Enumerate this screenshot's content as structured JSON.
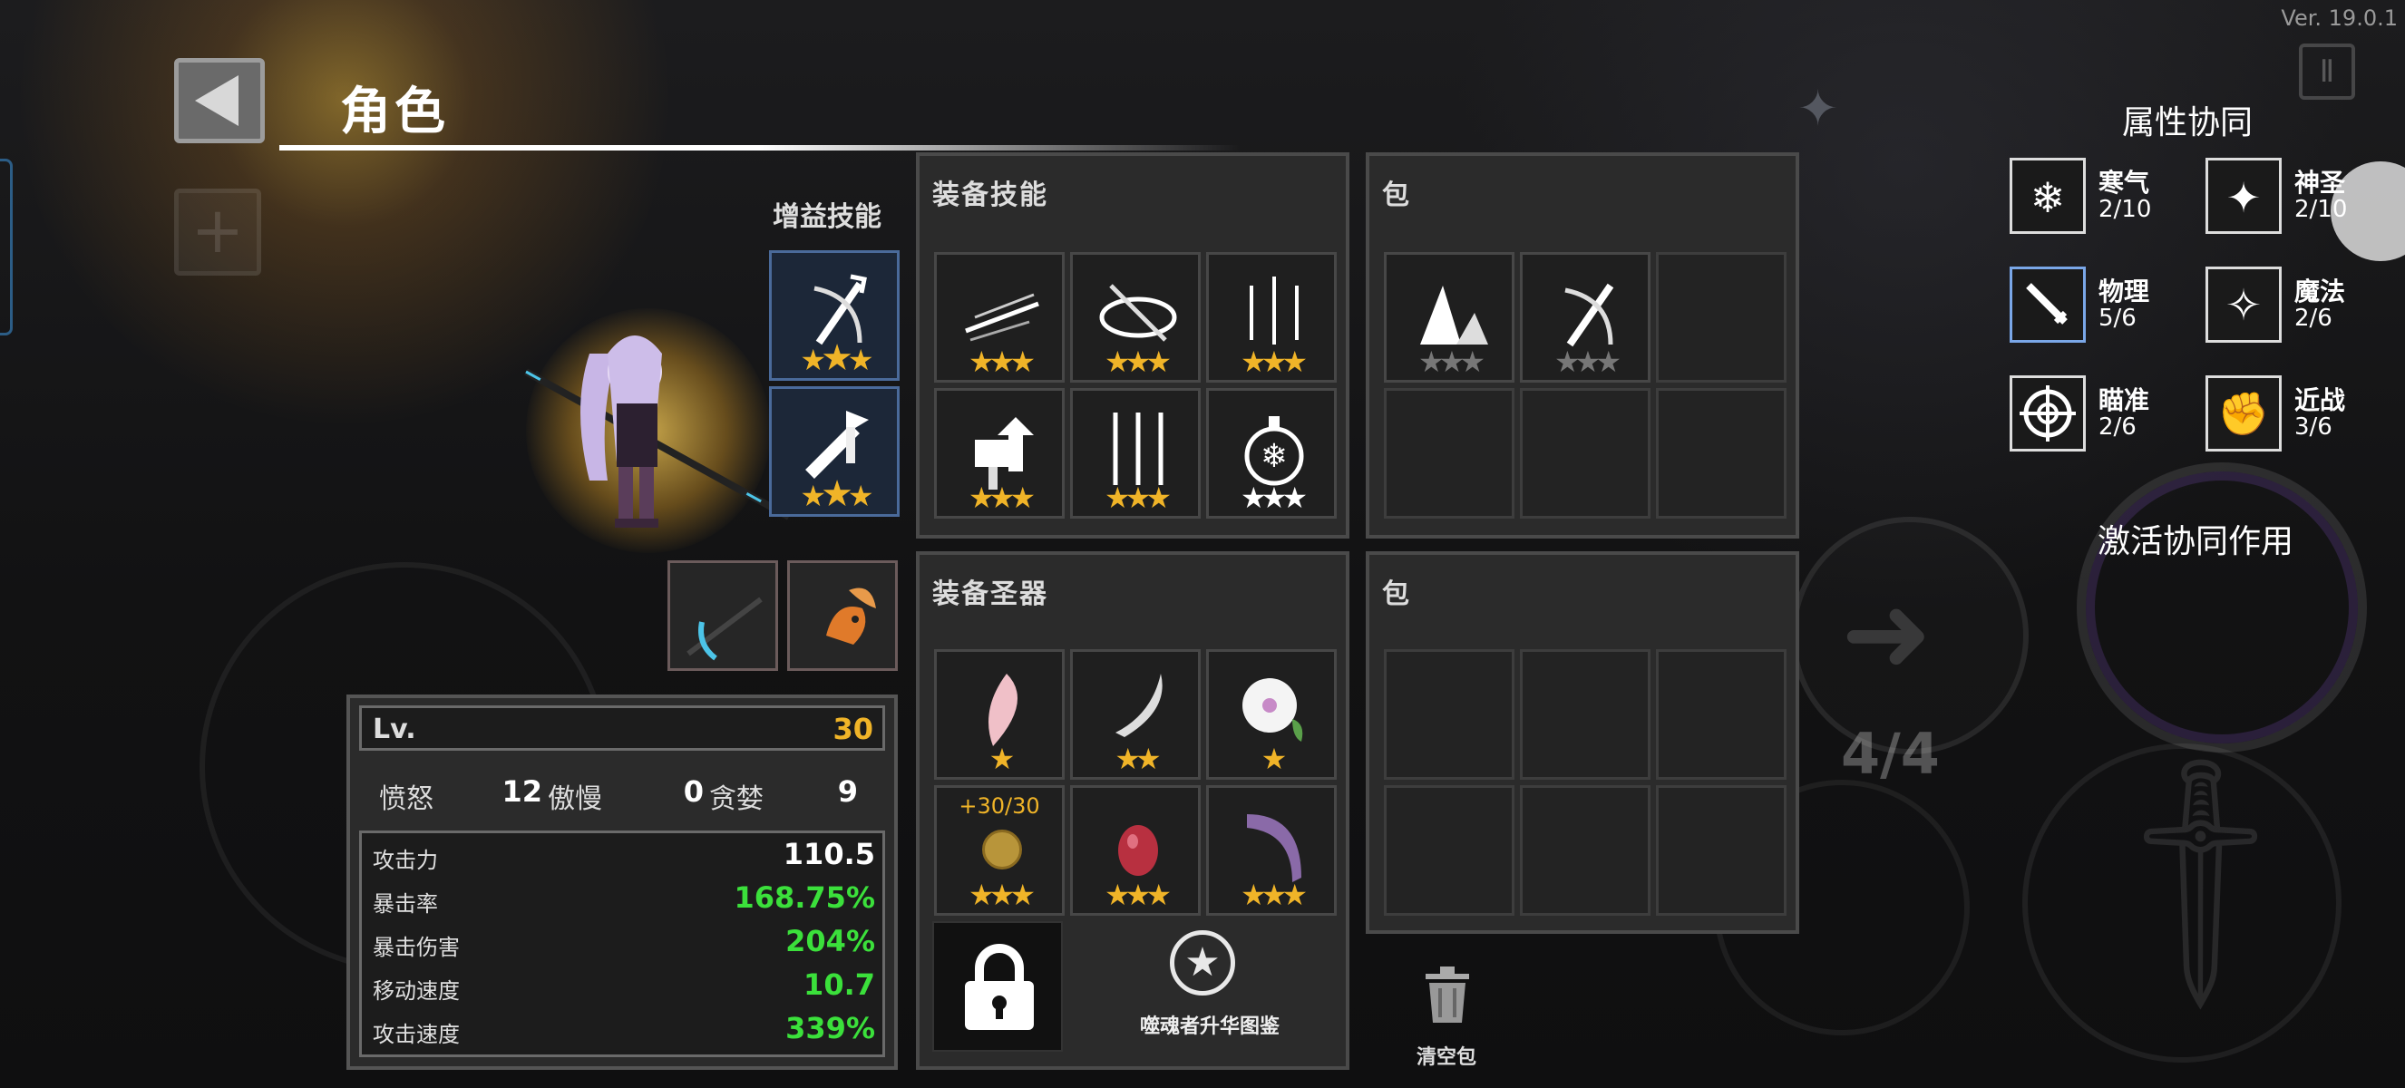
{
  "version": "Ver. 19.0.1",
  "header": {
    "title": "角色"
  },
  "buff_skills_label": "增益技能",
  "equip_skills": {
    "title": "装备技能",
    "slots": [
      {
        "icon": "slash-wind-icon",
        "stars": "★★★"
      },
      {
        "icon": "whirl-slash-icon",
        "stars": "★★★"
      },
      {
        "icon": "sword-rain-icon",
        "stars": "★★★"
      },
      {
        "icon": "hammer-up-icon",
        "stars": "★★★"
      },
      {
        "icon": "triple-spear-icon",
        "stars": "★★★"
      },
      {
        "icon": "frost-orb-icon",
        "stars": "★★★"
      }
    ]
  },
  "bag_skills": {
    "title": "包",
    "slots": [
      {
        "icon": "ground-spike-icon",
        "stars": "★★★"
      },
      {
        "icon": "bow-sword-icon",
        "stars": "★★★"
      }
    ]
  },
  "equip_relics": {
    "title": "装备圣器",
    "slots": [
      {
        "icon": "pink-feather-icon",
        "stars": "★"
      },
      {
        "icon": "curved-blade-icon",
        "stars": "★★"
      },
      {
        "icon": "white-flower-icon",
        "stars": "★"
      },
      {
        "icon": "gold-coin-icon",
        "stars": "★★★",
        "note": "+30/30"
      },
      {
        "icon": "red-egg-icon",
        "stars": "★★★"
      },
      {
        "icon": "purple-scythe-icon",
        "stars": "★★★"
      }
    ]
  },
  "bag_relics": {
    "title": "包"
  },
  "level": {
    "label": "Lv.",
    "value": "30"
  },
  "sins": [
    {
      "label": "愤怒",
      "value": "12"
    },
    {
      "label": "傲慢",
      "value": "0"
    },
    {
      "label": "贪婪",
      "value": "9"
    }
  ],
  "stats": [
    {
      "label": "攻击力",
      "value": "110.5",
      "color": "#ffffff"
    },
    {
      "label": "暴击率",
      "value": "168.75%",
      "color": "#3be03b"
    },
    {
      "label": "暴击伤害",
      "value": "204%",
      "color": "#3be03b"
    },
    {
      "label": "移动速度",
      "value": "10.7",
      "color": "#3be03b"
    },
    {
      "label": "攻击速度",
      "value": "339%",
      "color": "#3be03b"
    }
  ],
  "synergy": {
    "title": "属性协同",
    "items": [
      {
        "name": "寒气",
        "count": "2/10",
        "icon": "snowflake-icon"
      },
      {
        "name": "神圣",
        "count": "2/10",
        "icon": "holy-star-icon"
      },
      {
        "name": "物理",
        "count": "5/6",
        "icon": "sword-icon"
      },
      {
        "name": "魔法",
        "count": "2/6",
        "icon": "magic-star-icon"
      },
      {
        "name": "瞄准",
        "count": "2/6",
        "icon": "crosshair-icon"
      },
      {
        "name": "近战",
        "count": "3/6",
        "icon": "fist-icon"
      }
    ],
    "activate_label": "激活协同作用"
  },
  "bottom": {
    "upgrade_label": "噬魂者升华图鉴",
    "clear_label": "清空包",
    "ammo": "4/4"
  },
  "colors": {
    "level": "#f0b428",
    "green": "#3be03b",
    "panel": "#2b2b2b"
  }
}
